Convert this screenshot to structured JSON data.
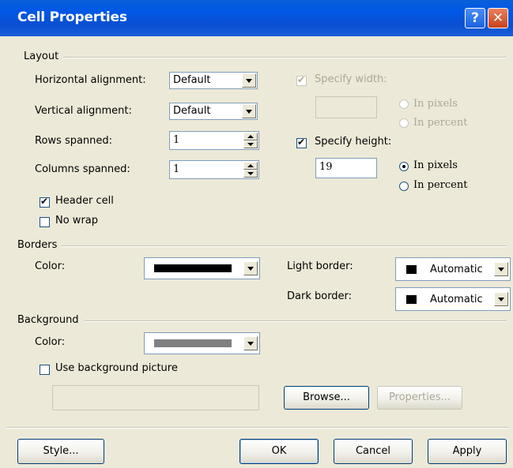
{
  "window": {
    "title": "Cell Properties",
    "help_glyph": "?",
    "close_glyph": "✕"
  },
  "layout": {
    "group_label": "Layout",
    "horizontal_alignment": {
      "label": "Horizontal alignment:",
      "value": "Default"
    },
    "vertical_alignment": {
      "label": "Vertical alignment:",
      "value": "Default"
    },
    "rows_spanned": {
      "label": "Rows spanned:",
      "value": "1"
    },
    "columns_spanned": {
      "label": "Columns spanned:",
      "value": "1"
    },
    "header_cell": {
      "label": "Header cell",
      "checked": true
    },
    "no_wrap": {
      "label": "No wrap",
      "checked": false
    },
    "specify_width": {
      "label": "Specify width:",
      "checked": true,
      "enabled": false,
      "value": "",
      "in_pixels": "In pixels",
      "in_percent": "In percent"
    },
    "specify_height": {
      "label": "Specify height:",
      "checked": true,
      "value": "19",
      "in_pixels": "In pixels",
      "in_percent": "In percent",
      "selected_unit": "In pixels"
    }
  },
  "borders": {
    "group_label": "Borders",
    "color_label": "Color:",
    "color_value": "#000000",
    "light_border_label": "Light border:",
    "light_border_value": "Automatic",
    "dark_border_label": "Dark border:",
    "dark_border_value": "Automatic"
  },
  "background": {
    "group_label": "Background",
    "color_label": "Color:",
    "color_value": "#808080",
    "use_picture_label": "Use background picture",
    "use_picture_checked": false,
    "picture_path": "",
    "browse_label": "Browse...",
    "properties_label": "Properties..."
  },
  "footer": {
    "style_label": "Style...",
    "ok_label": "OK",
    "cancel_label": "Cancel",
    "apply_label": "Apply"
  }
}
